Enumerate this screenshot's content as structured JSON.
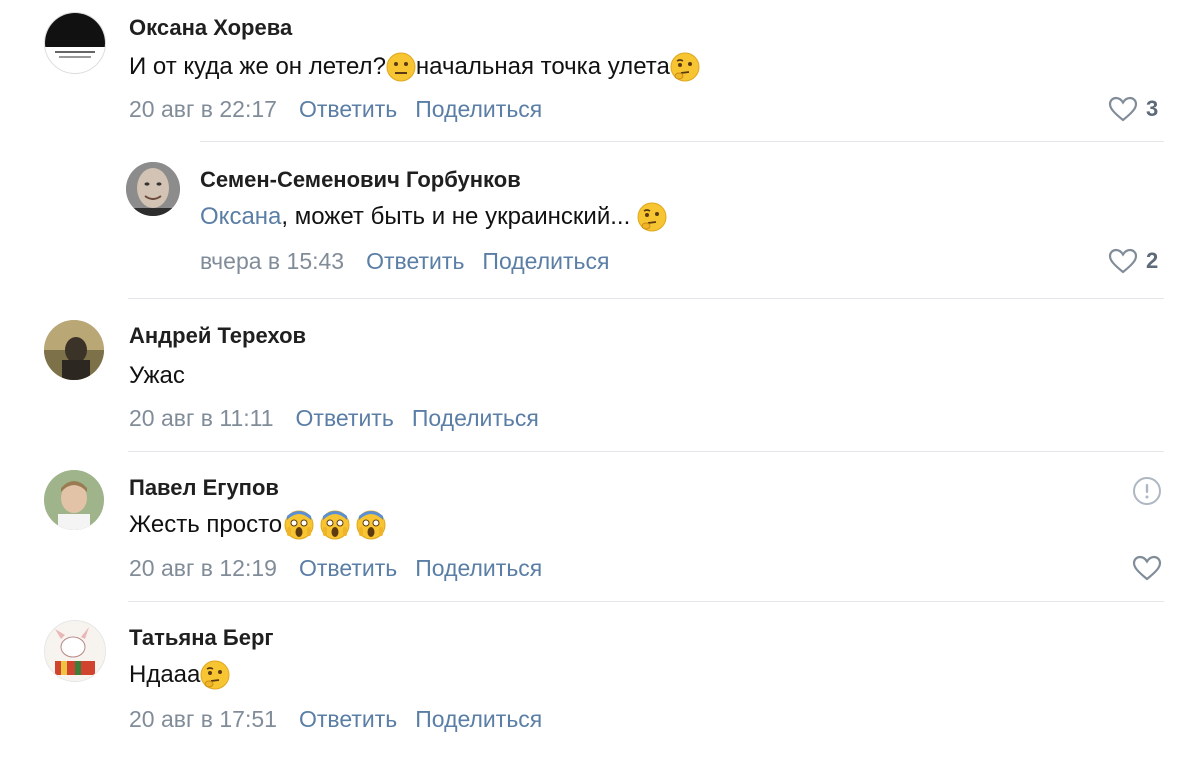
{
  "comments": [
    {
      "author": "Оксана Хорева",
      "text_before": "И от куда же он летел?",
      "text_middle": "начальная точка улета",
      "date": "20 авг в 22:17",
      "reply_label": "Ответить",
      "share_label": "Поделиться",
      "likes": "3",
      "emojis": [
        "neutral-face-emoji",
        "thinking-face-emoji"
      ]
    },
    {
      "author": "Семен-Семенович Горбунков",
      "mention": "Оксана",
      "text": ", может быть и не украинский... ",
      "date": "вчера в 15:43",
      "reply_label": "Ответить",
      "share_label": "Поделиться",
      "likes": "2",
      "emojis": [
        "thinking-face-emoji"
      ]
    },
    {
      "author": "Андрей Терехов",
      "text": "Ужас",
      "date": "20 авг в 11:11",
      "reply_label": "Ответить",
      "share_label": "Поделиться"
    },
    {
      "author": "Павел Егупов",
      "text": "Жесть просто",
      "date": "20 авг в 12:19",
      "reply_label": "Ответить",
      "share_label": "Поделиться",
      "emojis": [
        "screaming-face-emoji",
        "screaming-face-emoji",
        "screaming-face-emoji"
      ]
    },
    {
      "author": "Татьяна Берг",
      "text": "Ндааа",
      "date": "20 авг в 17:51",
      "reply_label": "Ответить",
      "share_label": "Поделиться",
      "emojis": [
        "thinking-face-emoji"
      ]
    }
  ],
  "colors": {
    "link": "#5a7ea5",
    "meta": "#818c99",
    "divider": "#e4e6ea",
    "emoji_yellow": "#f7c531"
  }
}
